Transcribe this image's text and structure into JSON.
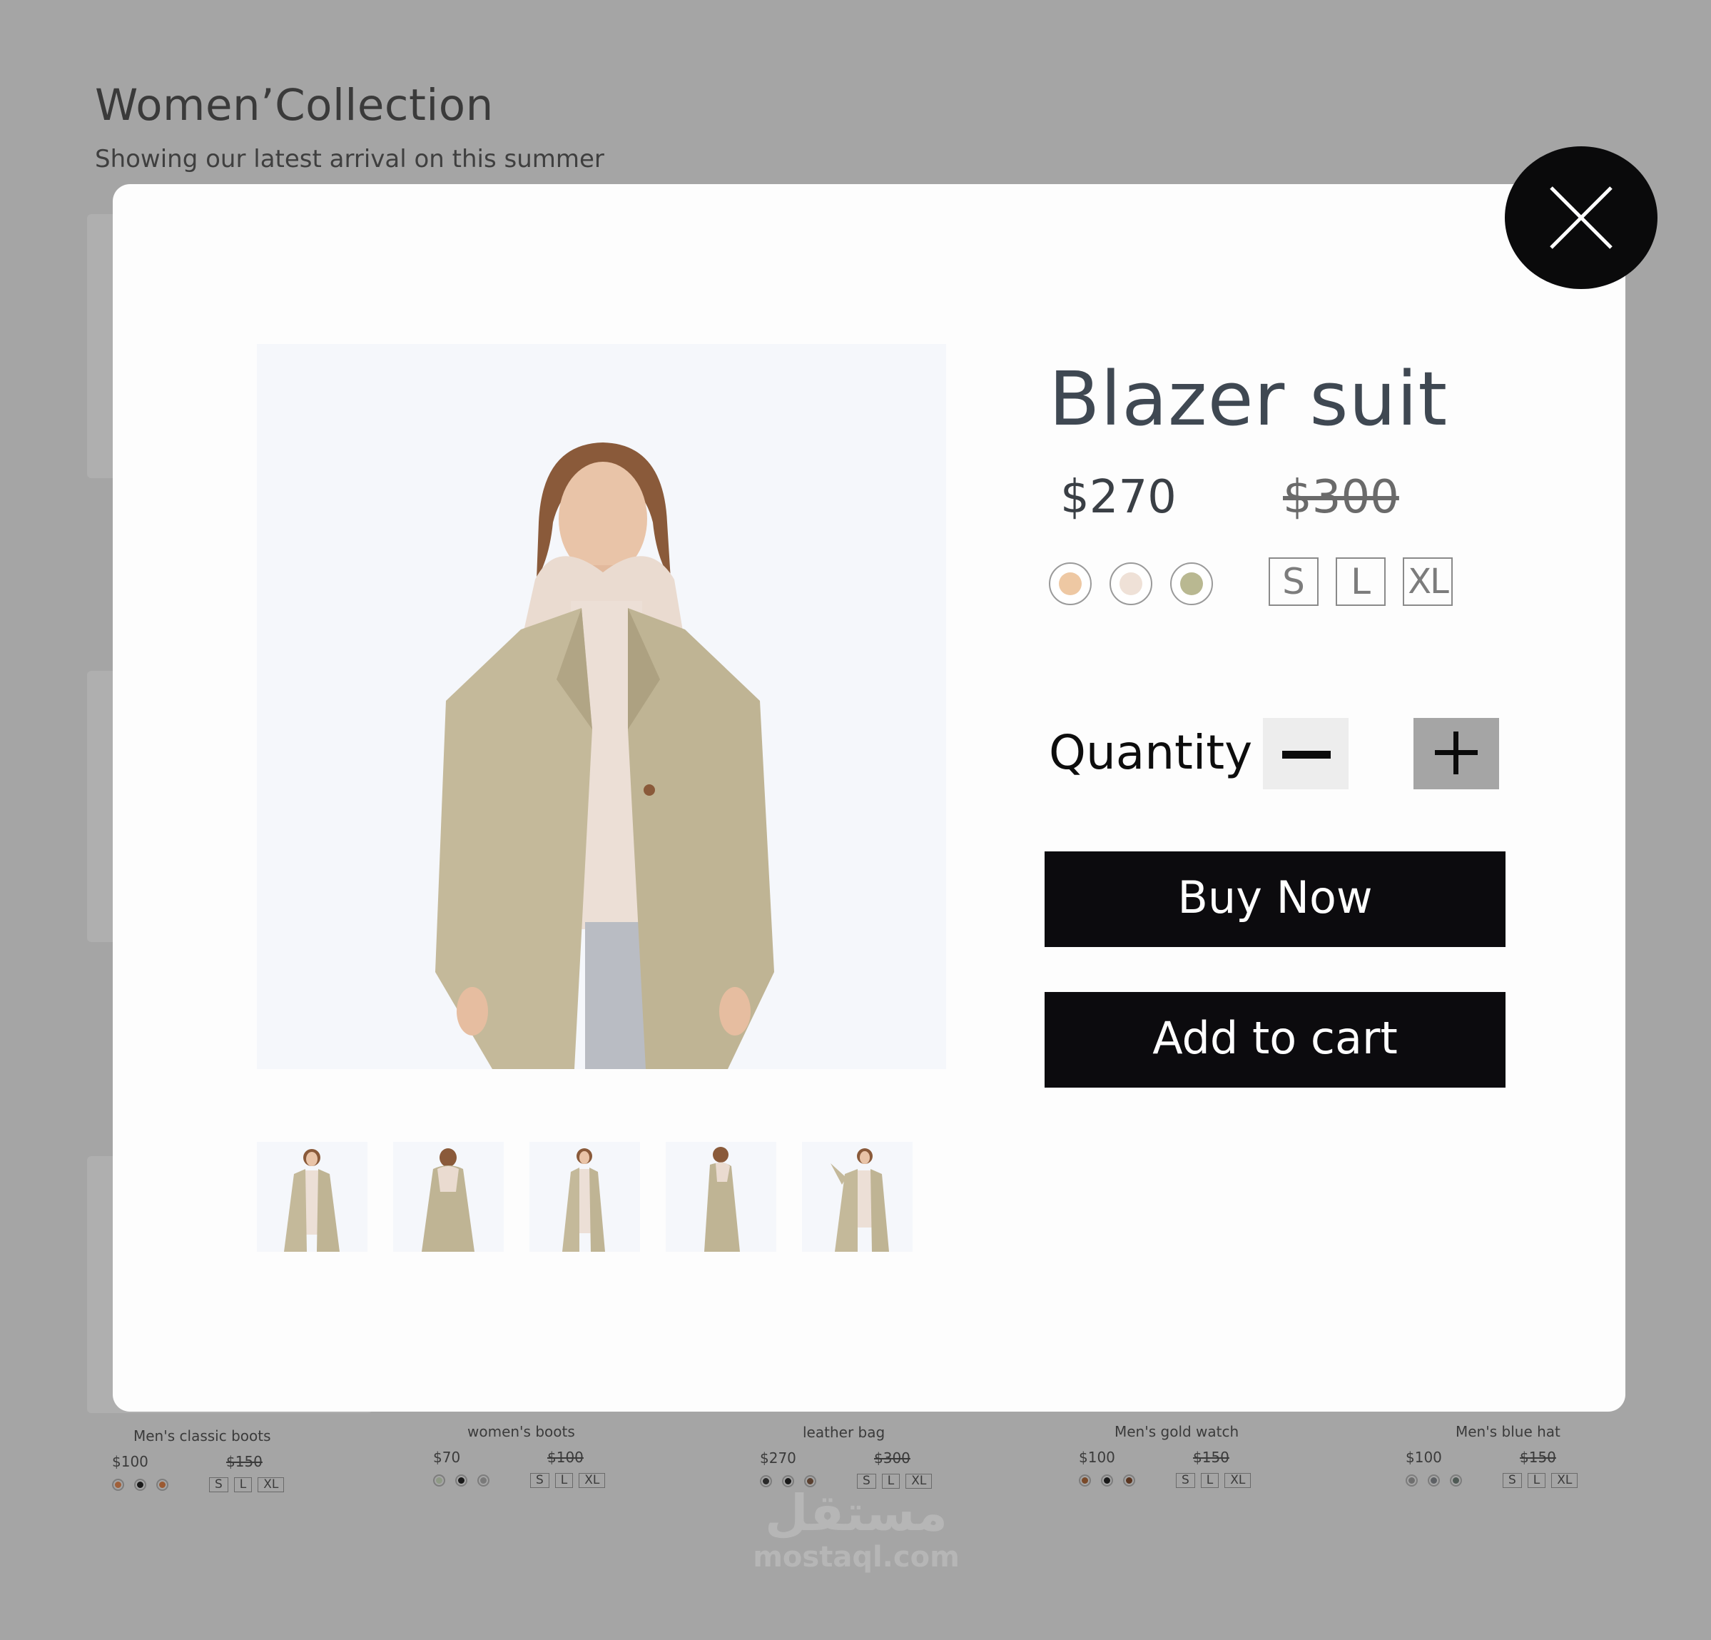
{
  "page": {
    "title": "Women’Collection",
    "subtitle": "Showing our latest arrival on this summer"
  },
  "products": [
    {
      "name": "Men's classic boots",
      "price": "$100",
      "old_price": "$150",
      "swatches": [
        "#a0603a",
        "#1a1a1a",
        "#9b5a32"
      ],
      "sizes": [
        "S",
        "L",
        "XL"
      ]
    },
    {
      "name": "women's boots",
      "price": "$70",
      "old_price": "$100",
      "swatches": [
        "#8f9a86",
        "#1a1a1a",
        "#7a7a7a"
      ],
      "sizes": [
        "S",
        "L",
        "XL"
      ]
    },
    {
      "name": "leather bag",
      "price": "$270",
      "old_price": "$300",
      "swatches": [
        "#2a2a2a",
        "#1a1a1a",
        "#5a4030"
      ],
      "sizes": [
        "S",
        "L",
        "XL"
      ]
    },
    {
      "name": "Men's gold watch",
      "price": "$100",
      "old_price": "$150",
      "swatches": [
        "#7a4a2a",
        "#1a1a1a",
        "#5a3520"
      ],
      "sizes": [
        "S",
        "L",
        "XL"
      ]
    },
    {
      "name": "Men's blue hat",
      "price": "$100",
      "old_price": "$150",
      "swatches": [
        "#6f6f6f",
        "#5e6165",
        "#4f5a55"
      ],
      "sizes": [
        "S",
        "L",
        "XL"
      ]
    }
  ],
  "watermark": {
    "arabic": "مستقل",
    "latin": "mostaql.com"
  },
  "modal": {
    "close_icon": "close-x-icon",
    "product_name": "Blazer suit",
    "price": "$270",
    "old_price": "$300",
    "colors": [
      "#eec8a3",
      "#efe1d7",
      "#b9b891"
    ],
    "sizes": [
      "S",
      "L",
      "XL"
    ],
    "quantity_label": "Quantity",
    "buy_now_label": "Buy Now",
    "add_to_cart_label": "Add to cart",
    "thumbnail_count": 5,
    "accent_color": "#0c0b0e"
  }
}
